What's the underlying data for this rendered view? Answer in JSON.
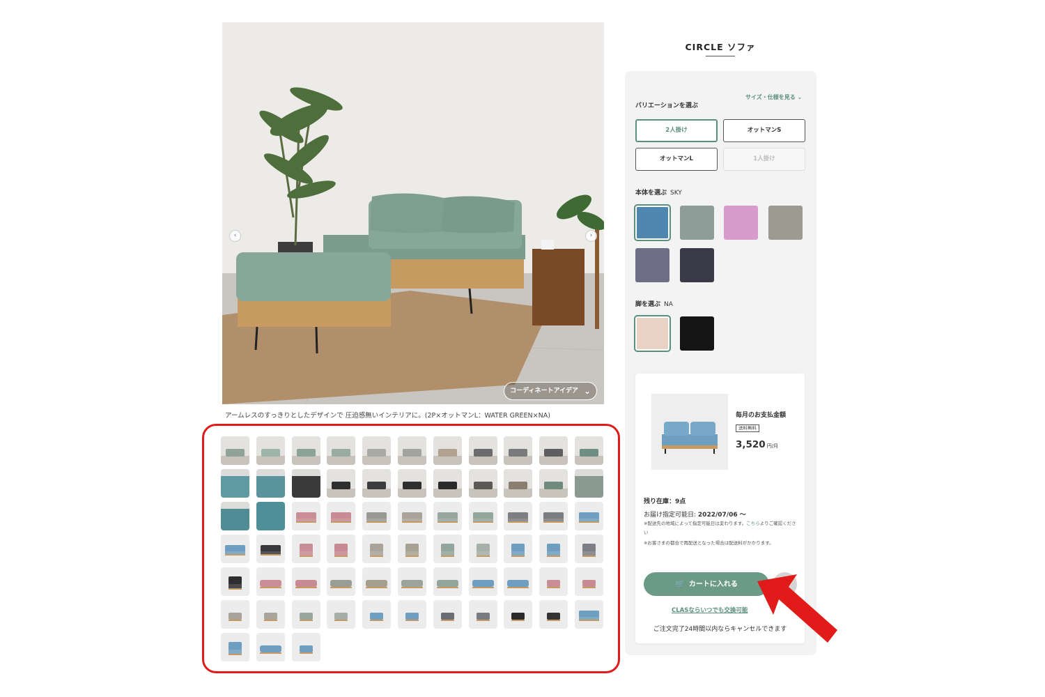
{
  "product": {
    "title": "CIRCLE ソファ"
  },
  "gallery": {
    "caption": "アームレスのすっきりとしたデザインで 圧迫感無いインテリアに。(2P×オットマンL：WATER GREEN×NA)",
    "coordinate_label": "コーディネートアイデア",
    "prev_icon": "‹",
    "next_icon": "›",
    "chevron_icon": "⌄",
    "thumbnails": [
      {
        "kind": "room",
        "c": "#8fa39a"
      },
      {
        "kind": "room",
        "c": "#9fb5ac"
      },
      {
        "kind": "room",
        "c": "#8ca399"
      },
      {
        "kind": "room",
        "c": "#98aca3"
      },
      {
        "kind": "room",
        "c": "#a9a9a6"
      },
      {
        "kind": "room",
        "c": "#a3a39f"
      },
      {
        "kind": "room",
        "c": "#b0a28f"
      },
      {
        "kind": "room",
        "c": "#6c6c6e"
      },
      {
        "kind": "room",
        "c": "#7a7a7c"
      },
      {
        "kind": "room",
        "c": "#5e5e60"
      },
      {
        "kind": "room",
        "c": "#6f8f84"
      },
      {
        "kind": "detail",
        "c": "#5f9aa3"
      },
      {
        "kind": "detail",
        "c": "#5b949c"
      },
      {
        "kind": "detail",
        "c": "#3a3a3a"
      },
      {
        "kind": "room",
        "c": "#2f2f30"
      },
      {
        "kind": "room",
        "c": "#3c3c3e"
      },
      {
        "kind": "room",
        "c": "#2e2e2f"
      },
      {
        "kind": "room",
        "c": "#2a2a2b"
      },
      {
        "kind": "room",
        "c": "#5b5856"
      },
      {
        "kind": "room",
        "c": "#8a7f6e"
      },
      {
        "kind": "room",
        "c": "#6e8b7e"
      },
      {
        "kind": "detail",
        "c": "#8a9a90"
      },
      {
        "kind": "detail",
        "c": "#4f8c96"
      },
      {
        "kind": "fabric",
        "c": "#4e8f98"
      },
      {
        "kind": "sofa",
        "c": "#c98d96"
      },
      {
        "kind": "sofa",
        "c": "#c88a93"
      },
      {
        "kind": "sofa",
        "c": "#9a9a95"
      },
      {
        "kind": "sofa",
        "c": "#a9a49a"
      },
      {
        "kind": "sofa",
        "c": "#98a6a0"
      },
      {
        "kind": "sofa",
        "c": "#93a69d"
      },
      {
        "kind": "sofa",
        "c": "#7e7f82"
      },
      {
        "kind": "sofa",
        "c": "#7b7c80"
      },
      {
        "kind": "sofa",
        "c": "#6e9fc0"
      },
      {
        "kind": "sofa",
        "c": "#6e9fc0"
      },
      {
        "kind": "sofa",
        "c": "#3a3a3c"
      },
      {
        "kind": "chair",
        "c": "#c98d96"
      },
      {
        "kind": "chair",
        "c": "#c88a93"
      },
      {
        "kind": "chair",
        "c": "#a9a49a"
      },
      {
        "kind": "chair",
        "c": "#a6a294"
      },
      {
        "kind": "chair",
        "c": "#93a69d"
      },
      {
        "kind": "chair",
        "c": "#a4b0a8"
      },
      {
        "kind": "chair",
        "c": "#6e9fc0"
      },
      {
        "kind": "chair",
        "c": "#6e9fc0"
      },
      {
        "kind": "chair",
        "c": "#7e7f84"
      },
      {
        "kind": "chair",
        "c": "#2e2e30"
      },
      {
        "kind": "ottoman",
        "c": "#c98d96"
      },
      {
        "kind": "ottoman",
        "c": "#c88a93"
      },
      {
        "kind": "ottoman",
        "c": "#9a9d94"
      },
      {
        "kind": "ottoman",
        "c": "#a49f90"
      },
      {
        "kind": "ottoman",
        "c": "#9aa39c"
      },
      {
        "kind": "ottoman",
        "c": "#93a69d"
      },
      {
        "kind": "ottoman",
        "c": "#6e9fc0"
      },
      {
        "kind": "ottoman",
        "c": "#6e9fc0"
      },
      {
        "kind": "small",
        "c": "#c98d96"
      },
      {
        "kind": "small",
        "c": "#c88a93"
      },
      {
        "kind": "small",
        "c": "#a9a49a"
      },
      {
        "kind": "small",
        "c": "#aaa59b"
      },
      {
        "kind": "small",
        "c": "#98a6a0"
      },
      {
        "kind": "small",
        "c": "#a6aea8"
      },
      {
        "kind": "small",
        "c": "#6e9fc0"
      },
      {
        "kind": "small",
        "c": "#6e9fc0"
      },
      {
        "kind": "small",
        "c": "#6c6d74"
      },
      {
        "kind": "small",
        "c": "#7a7b82"
      },
      {
        "kind": "small",
        "c": "#2a2a2b"
      },
      {
        "kind": "small",
        "c": "#333334"
      },
      {
        "kind": "sofa",
        "c": "#6e9fc0"
      },
      {
        "kind": "chair",
        "c": "#6e9fc0"
      },
      {
        "kind": "ottoman",
        "c": "#6e9fc0"
      },
      {
        "kind": "small",
        "c": "#6e9fc0"
      }
    ]
  },
  "options": {
    "size_link": "サイズ・仕様を見る ⌄",
    "variation_label": "バリエーションを選ぶ",
    "variations": [
      {
        "label": "2人掛け",
        "state": "active"
      },
      {
        "label": "オットマンS",
        "state": "normal"
      },
      {
        "label": "オットマンL",
        "state": "normal"
      },
      {
        "label": "1人掛け",
        "state": "disabled"
      }
    ],
    "body_label": "本体を選ぶ",
    "body_selected": "SKY",
    "body_colors": [
      "#4f86ad",
      "#8f9d98",
      "#d89ccc",
      "#9d9a91",
      "#6e6f86",
      "#3a3948"
    ],
    "leg_label": "脚を選ぶ",
    "leg_selected": "NA",
    "leg_colors": [
      "#e9d2c4",
      "#141414"
    ]
  },
  "purchase": {
    "monthly_label": "毎月のお支払金額",
    "shipping_badge": "送料無料",
    "price": "3,520",
    "price_unit": "円/月",
    "stock": "残り在庫：9点",
    "delivery_label": "お届け指定可能日:",
    "delivery_date": "2022/07/06 ～",
    "note1_pre": "※配送先の地域によって指定可能日は変わります。",
    "note1_link": "こちら",
    "note1_post": "よりご確認ください",
    "note2": "※お客さまの都合で再配送となった場合は配送料がかかります。",
    "cart_label": "カートに入れる",
    "cart_icon": "🛒",
    "exchange_link": "CLASならいつでも交換可能",
    "cancel_note": "ご注文完了24時間以内ならキャンセルできます"
  },
  "colors": {
    "accent": "#6b9a87",
    "highlight": "#e11a1a"
  }
}
